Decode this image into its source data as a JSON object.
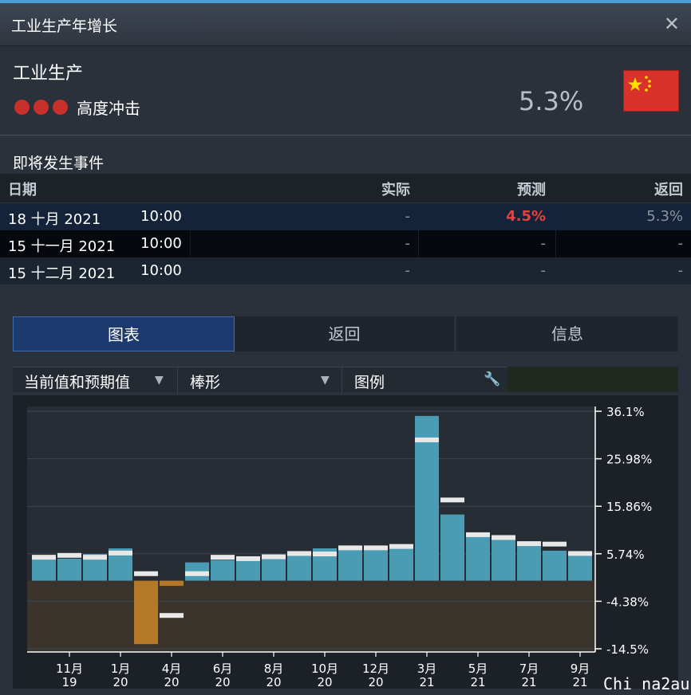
{
  "window": {
    "title": "工业生产年增长"
  },
  "summary": {
    "name": "工业生产",
    "impact_label": "高度冲击",
    "impact_level": 3,
    "value": "5.3%",
    "country_flag": "china-flag"
  },
  "events": {
    "title": "即将发生事件",
    "headers": {
      "date": "日期",
      "actual": "实际",
      "forecast": "预测",
      "previous": "返回"
    },
    "rows": [
      {
        "date": "18 十月 2021",
        "time": "10:00",
        "actual": "-",
        "forecast": "4.5%",
        "previous": "5.3%"
      },
      {
        "date": "15 十一月 2021",
        "time": "10:00",
        "actual": "-",
        "forecast": "-",
        "previous": "-"
      },
      {
        "date": "15 十二月 2021",
        "time": "10:00",
        "actual": "-",
        "forecast": "-",
        "previous": "-"
      }
    ]
  },
  "tabs": [
    {
      "label": "图表",
      "active": true
    },
    {
      "label": "返回",
      "active": false
    },
    {
      "label": "信息",
      "active": false
    }
  ],
  "toolbar": {
    "series_select": "当前值和预期值",
    "chart_type_select": "棒形",
    "legend": "图例"
  },
  "colors": {
    "positive_bar": "#4a9bb4",
    "negative_bar": "#b47a2a",
    "forecast_mark": "#e8e8e8",
    "accent_tab": "#1c3a6e",
    "impact_dot": "#c8302b"
  },
  "watermark": "Chi na2au",
  "chart_data": {
    "type": "bar",
    "ylim": [
      -14.5,
      36.1
    ],
    "yticks": [
      "36.1%",
      "25.98%",
      "15.86%",
      "5.74%",
      "-4.38%",
      "-14.5%"
    ],
    "ytick_values": [
      36.1,
      25.98,
      15.86,
      5.74,
      -4.38,
      -14.5
    ],
    "xtick_labels": [
      {
        "month": "11月",
        "year": "19",
        "index": 1
      },
      {
        "month": "1月",
        "year": "20",
        "index": 3
      },
      {
        "month": "4月",
        "year": "20",
        "index": 5
      },
      {
        "month": "6月",
        "year": "20",
        "index": 7
      },
      {
        "month": "8月",
        "year": "20",
        "index": 9
      },
      {
        "month": "10月",
        "year": "20",
        "index": 11
      },
      {
        "month": "12月",
        "year": "20",
        "index": 13
      },
      {
        "month": "3月",
        "year": "21",
        "index": 15
      },
      {
        "month": "5月",
        "year": "21",
        "index": 17
      },
      {
        "month": "7月",
        "year": "21",
        "index": 19
      },
      {
        "month": "9月",
        "year": "21",
        "index": 21
      }
    ],
    "series": [
      {
        "values": [
          5.4,
          4.7,
          5.7,
          6.9,
          -13.5,
          -1.1,
          3.9,
          4.4,
          4.8,
          5.6,
          5.6,
          6.9,
          6.9,
          7.3,
          7.3,
          35.1,
          14.1,
          9.8,
          8.8,
          8.3,
          6.4,
          5.3
        ],
        "forecast": [
          5.0,
          5.4,
          5.0,
          5.9,
          1.5,
          -7.4,
          1.5,
          5.0,
          4.7,
          5.1,
          5.8,
          5.7,
          7.0,
          7.0,
          7.3,
          30.0,
          17.2,
          9.8,
          9.2,
          7.9,
          7.8,
          5.8
        ]
      }
    ]
  }
}
